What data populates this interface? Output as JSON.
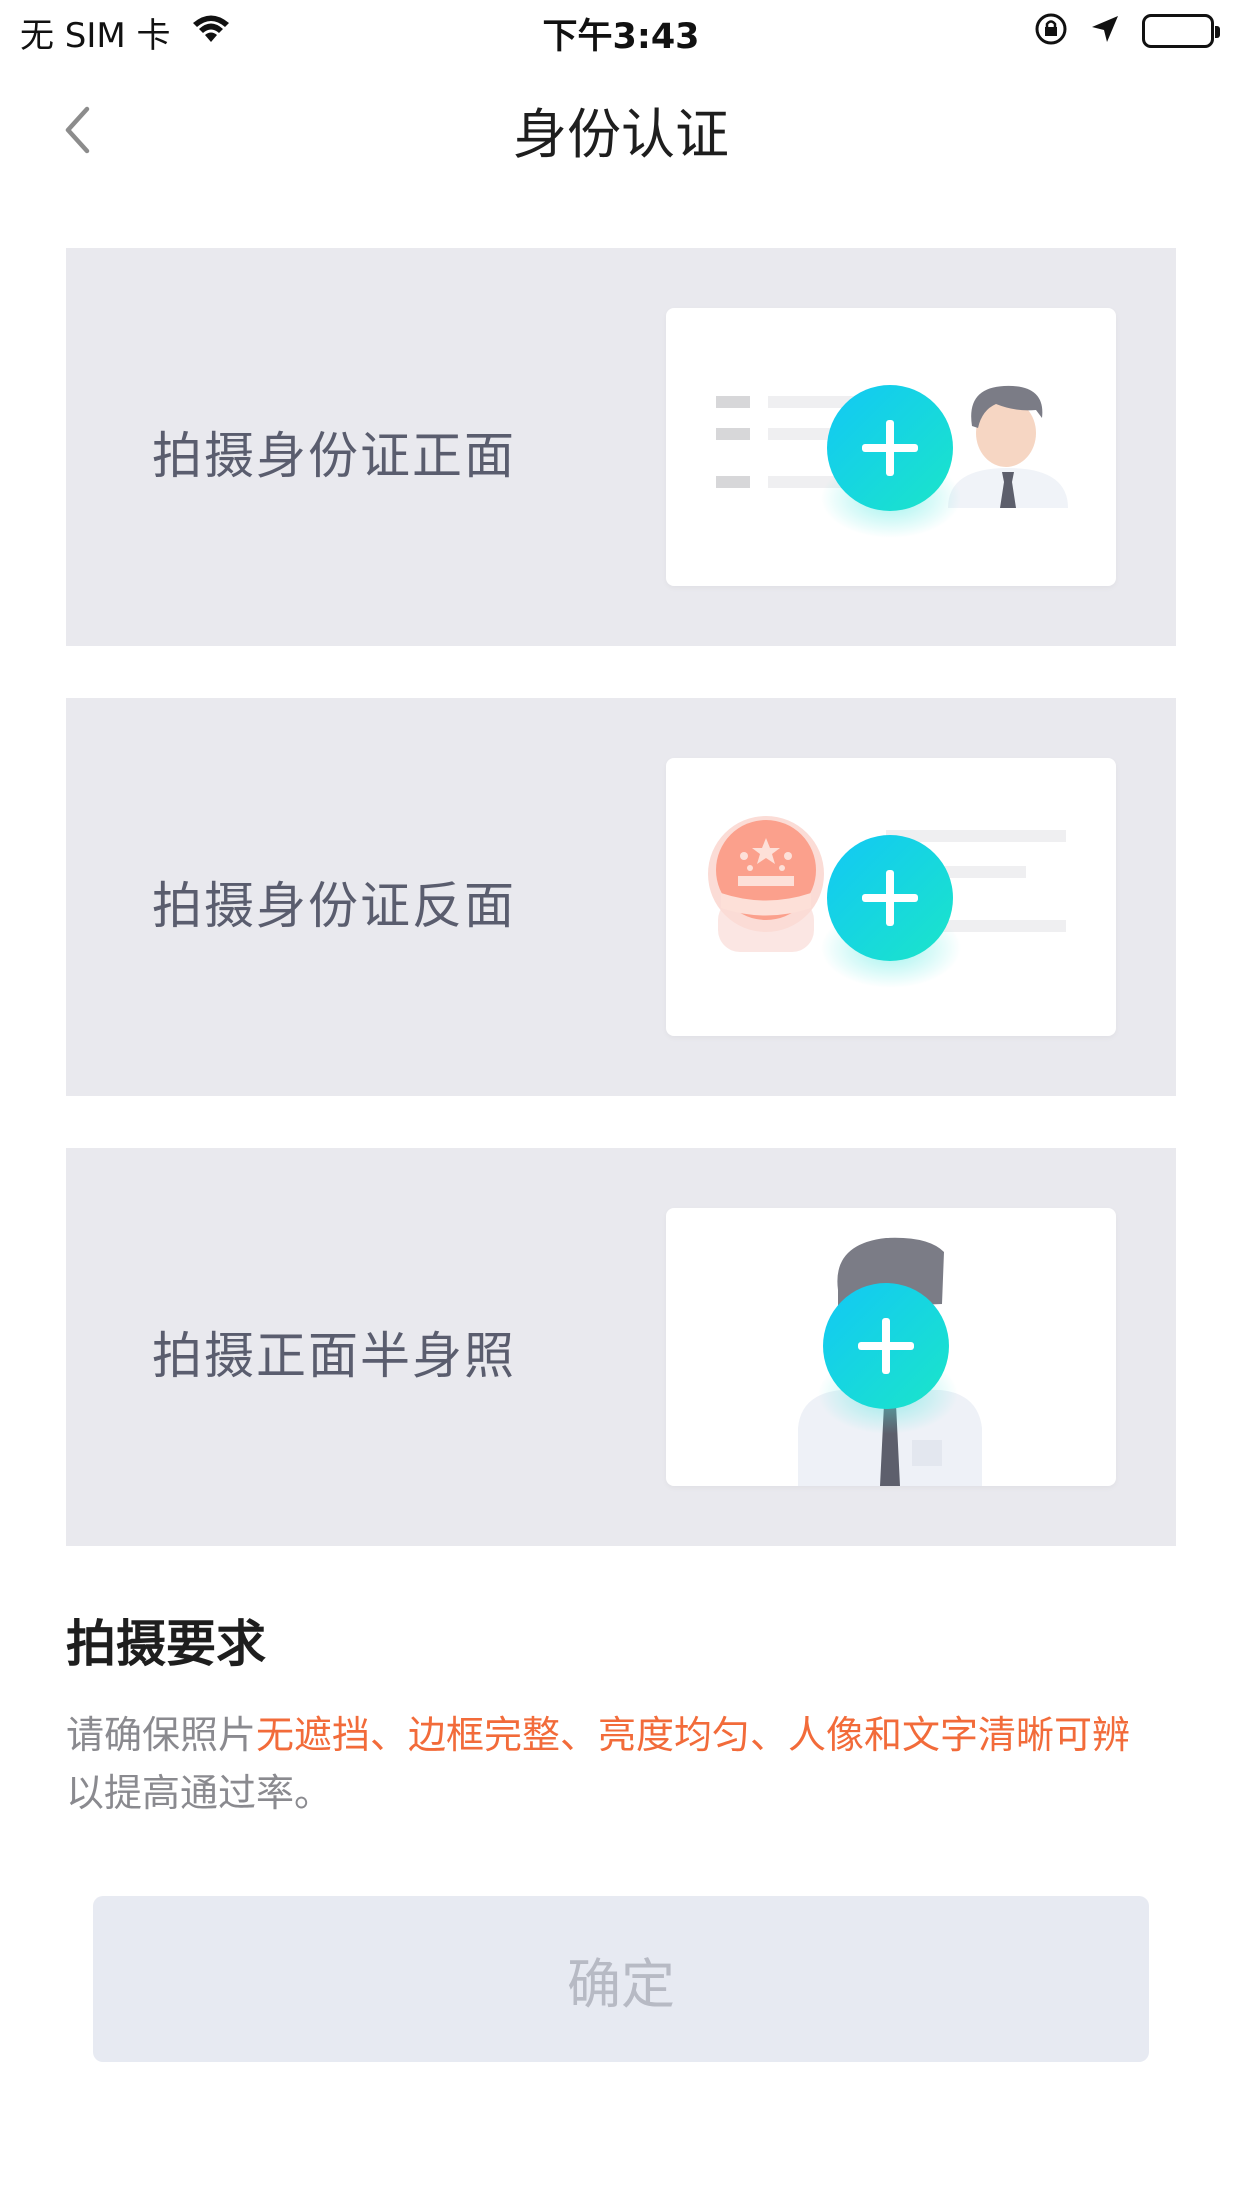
{
  "status_bar": {
    "carrier": "无 SIM 卡",
    "time": "下午3:43"
  },
  "nav": {
    "title": "身份认证"
  },
  "cards": [
    {
      "label": "拍摄身份证正面",
      "illustration": "id-front-illustration"
    },
    {
      "label": "拍摄身份证反面",
      "illustration": "id-back-illustration"
    },
    {
      "label": "拍摄正面半身照",
      "illustration": "half-body-photo-illustration"
    }
  ],
  "requirements": {
    "title": "拍摄要求",
    "text_prefix": "请确保照片",
    "text_highlight": "无遮挡、边框完整、亮度均匀、人像和文字清晰可辨",
    "text_suffix": "以提高通过率。"
  },
  "confirm_button": {
    "label": "确定"
  },
  "colors": {
    "card_bg": "#e9e9ee",
    "highlight": "#f26b3a",
    "plus_gradient_start": "#12c8f5",
    "plus_gradient_end": "#1be5c9",
    "button_bg": "#e7eaf2",
    "button_text": "#b7bac4"
  }
}
